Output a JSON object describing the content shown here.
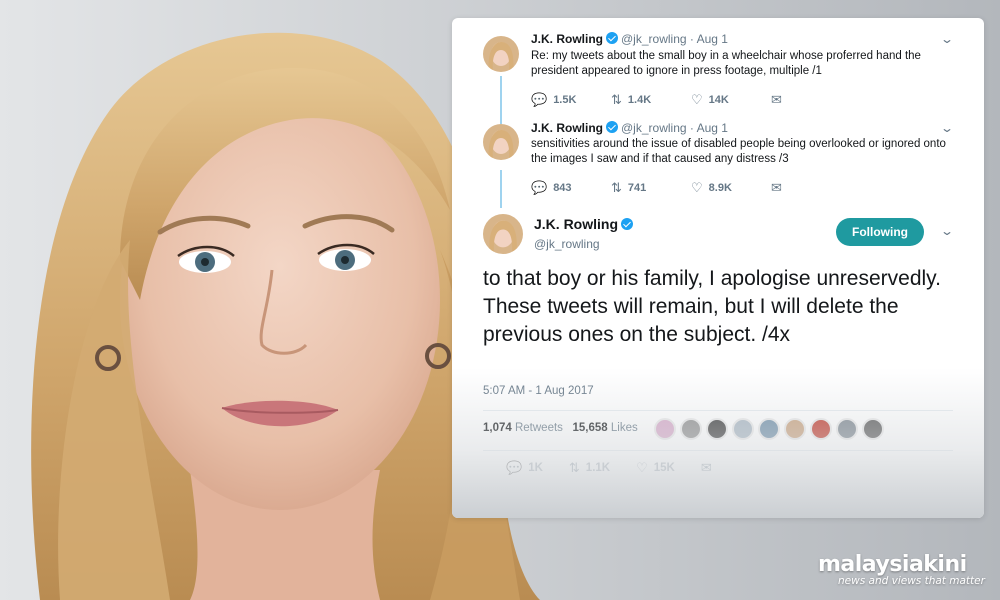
{
  "thread": [
    {
      "name": "J.K. Rowling",
      "handle": "@jk_rowling",
      "separator": "·",
      "date": "Aug 1",
      "text": "Re: my tweets about the small boy in a wheelchair whose proferred hand the president appeared to ignore in press footage, multiple /1",
      "replies": "1.5K",
      "retweets": "1.4K",
      "likes": "14K"
    },
    {
      "name": "J.K. Rowling",
      "handle": "@jk_rowling",
      "separator": "·",
      "date": "Aug 1",
      "text": "sensitivities around the issue of disabled people being overlooked or ignored onto the images I saw and if that caused any distress /3",
      "replies": "843",
      "retweets": "741",
      "likes": "8.9K"
    }
  ],
  "main_tweet": {
    "name": "J.K. Rowling",
    "handle": "@jk_rowling",
    "follow_label": "Following",
    "text": "to that boy or his family, I apologise unreservedly. These tweets will remain, but I will delete the previous ones on the subject. /4x",
    "timestamp": "5:07 AM - 1 Aug 2017",
    "retweet_count": "1,074",
    "retweet_label": "Retweets",
    "like_count": "15,658",
    "like_label": "Likes",
    "action_replies": "1K",
    "action_retweets": "1.1K",
    "action_likes": "15K"
  },
  "likers_colors": [
    "#d7a9c9",
    "#8e8e8e",
    "#3a3a3a",
    "#a9b7c3",
    "#6f8fa8",
    "#c9a27e",
    "#c0392b",
    "#7d8790",
    "#5a5a5a"
  ],
  "icons": {
    "reply": "reply-icon",
    "retweet": "retweet-icon",
    "like": "heart-icon",
    "message": "envelope-icon",
    "menu": "chevron-down-icon",
    "verified": "verified-badge-icon"
  },
  "colors": {
    "follow_button": "#1f9aa0",
    "verified": "#1da1f2",
    "thread_line": "#9fd3ef"
  },
  "watermark": {
    "name": "malaysiakini",
    "tagline": "news and views that matter"
  }
}
